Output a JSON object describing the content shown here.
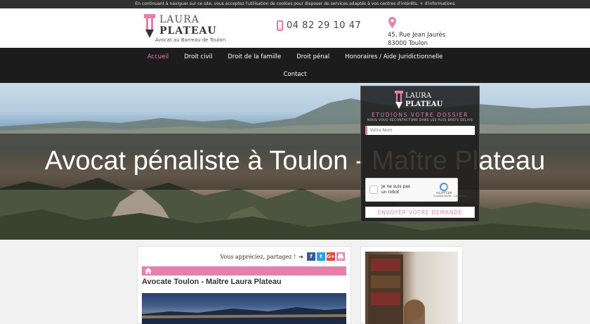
{
  "cookie_bar": {
    "text": "En continuant à naviguer sur ce site, vous acceptez l'utilisation de cookies pour disposer de services adaptés à vos centres d'intérêts.",
    "link": "+ d'informations"
  },
  "header": {
    "logo_line1": "LAURA",
    "logo_line2": "PLATEAU",
    "logo_sub": "Avocat au Barreau de Toulon",
    "phone": "04 82 29 10 47",
    "address_line1": "45, Rue Jean Jaurès",
    "address_line2": "83000 Toulon"
  },
  "nav": {
    "items": [
      "Accueil",
      "Droit civil",
      "Droit de la famille",
      "Droit pénal",
      "Honoraires / Aide Juridictionnelle"
    ],
    "items_row2": [
      "Contact"
    ]
  },
  "hero": {
    "title": "Avocat pénaliste à Toulon - Maître Plateau"
  },
  "form": {
    "logo_line1": "LAURA",
    "logo_line2": "PLATEAU",
    "title": "ETUDIONS VOTRE DOSSIER",
    "subtitle": "NOUS VOUS RECONTACTONS DANS LES PLUS BREFS DELAIS",
    "name_placeholder": "Votre Nom",
    "captcha_label": "Je ne suis pas un robot",
    "captcha_brand": "reCAPTCHA",
    "captcha_links": "Confidentialité - Conditions",
    "submit": "ENVOYER VOTRE DEMANDE"
  },
  "content": {
    "share_label": "Vous appréciez, partagez !",
    "share_buttons": [
      "f",
      "t",
      "G+",
      "p"
    ],
    "page_title": "Avocate Toulon - Maître Laura Plateau"
  },
  "colors": {
    "accent": "#e57fab",
    "nav_bg": "#1c1c1c",
    "facebook": "#3b5998",
    "twitter": "#1da1f2",
    "google": "#dd4b39",
    "print": "#e57fab"
  }
}
